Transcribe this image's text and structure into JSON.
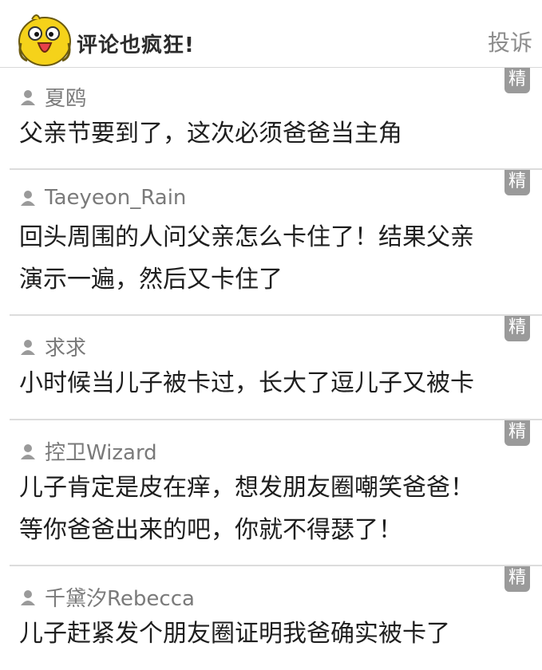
{
  "header": {
    "title": "评论也疯狂!",
    "report_label": "投诉"
  },
  "badge_label": "精",
  "comments": [
    {
      "user": "夏鸥",
      "text": [
        "父亲节要到了，这次必须爸爸当主角"
      ]
    },
    {
      "user": "Taeyeon_Rain",
      "text": [
        "回头周围的人问父亲怎么卡住了！结果父亲",
        "演示一遍，然后又卡住了"
      ]
    },
    {
      "user": "求求",
      "text": [
        "小时候当儿子被卡过，长大了逗儿子又被卡"
      ]
    },
    {
      "user": "控卫Wizard",
      "text": [
        "儿子肯定是皮在痒，想发朋友圈嘲笑爸爸！",
        "等你爸爸出来的吧，你就不得瑟了！"
      ]
    },
    {
      "user": "千黛汐Rebecca",
      "text": [
        "儿子赶紧发个朋友圈证明我爸确实被卡了"
      ]
    }
  ]
}
